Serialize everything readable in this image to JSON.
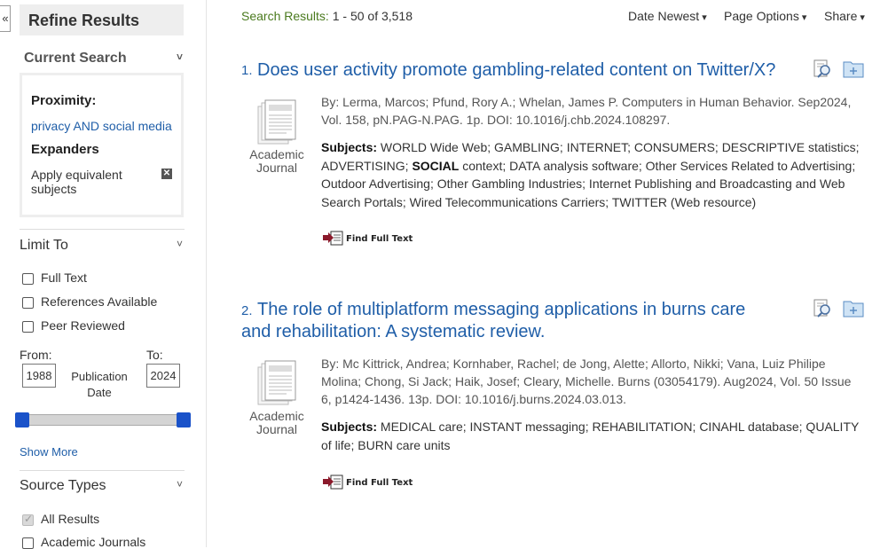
{
  "sidebar": {
    "collapse_label": "«",
    "refine_title": "Refine Results",
    "current_search": {
      "heading": "Current Search",
      "proximity_label": "Proximity:",
      "proximity_value": "privacy AND social media",
      "expanders_label": "Expanders",
      "expander_item": "Apply equivalent subjects"
    },
    "limit_to": {
      "heading": "Limit To",
      "options": [
        "Full Text",
        "References Available",
        "Peer Reviewed"
      ],
      "from_label": "From:",
      "to_label": "To:",
      "from_value": "1988",
      "to_value": "2024",
      "date_label": "Publication Date",
      "show_more": "Show More"
    },
    "source_types": {
      "heading": "Source Types",
      "options": [
        "All Results",
        "Academic Journals"
      ]
    }
  },
  "header": {
    "results_label": "Search Results:",
    "results_range": "1 - 50 of 3,518",
    "sort_label": "Date Newest",
    "page_options_label": "Page Options",
    "share_label": "Share"
  },
  "results": [
    {
      "number": "1.",
      "title": "Does user activity promote gambling-related content on Twitter/X?",
      "pub_type": "Academic Journal",
      "byline": "By: Lerma, Marcos; Pfund, Rory A.; Whelan, James P. Computers in Human Behavior. Sep2024, Vol. 158, pN.PAG-N.PAG. 1p. DOI: 10.1016/j.chb.2024.108297.",
      "subjects_label": "Subjects:",
      "subjects_pre": "WORLD Wide Web; GAMBLING; INTERNET; CONSUMERS; DESCRIPTIVE statistics; ADVERTISING;",
      "subjects_bold": "SOCIAL",
      "subjects_post": "context; DATA analysis software; Other Services Related to Advertising; Outdoor Advertising; Other Gambling Industries; Internet Publishing and Broadcasting and Web Search Portals; Wired Telecommunications Carriers; TWITTER (Web resource)",
      "full_text_label": "Find Full Text"
    },
    {
      "number": "2.",
      "title_line1": "The role of multiplatform messaging applications in burns care",
      "title_line2": "and rehabilitation: A systematic review.",
      "pub_type": "Academic Journal",
      "byline": "By: Mc Kittrick, Andrea; Kornhaber, Rachel; de Jong, Alette; Allorto, Nikki; Vana, Luiz Philipe Molina; Chong, Si Jack; Haik, Josef; Cleary, Michelle. Burns (03054179). Aug2024, Vol. 50 Issue 6, p1424-1436. 13p. DOI: 10.1016/j.burns.2024.03.013.",
      "subjects_label": "Subjects:",
      "subjects": "MEDICAL care; INSTANT messaging; REHABILITATION; CINAHL database; QUALITY of life; BURN care units",
      "full_text_label": "Find Full Text"
    }
  ],
  "colors": {
    "link": "#1f5ea8",
    "results_label": "#4a7a1e",
    "slider_handle": "#1a52c9"
  },
  "slider": {
    "from_fraction": 0,
    "to_fraction": 1
  }
}
